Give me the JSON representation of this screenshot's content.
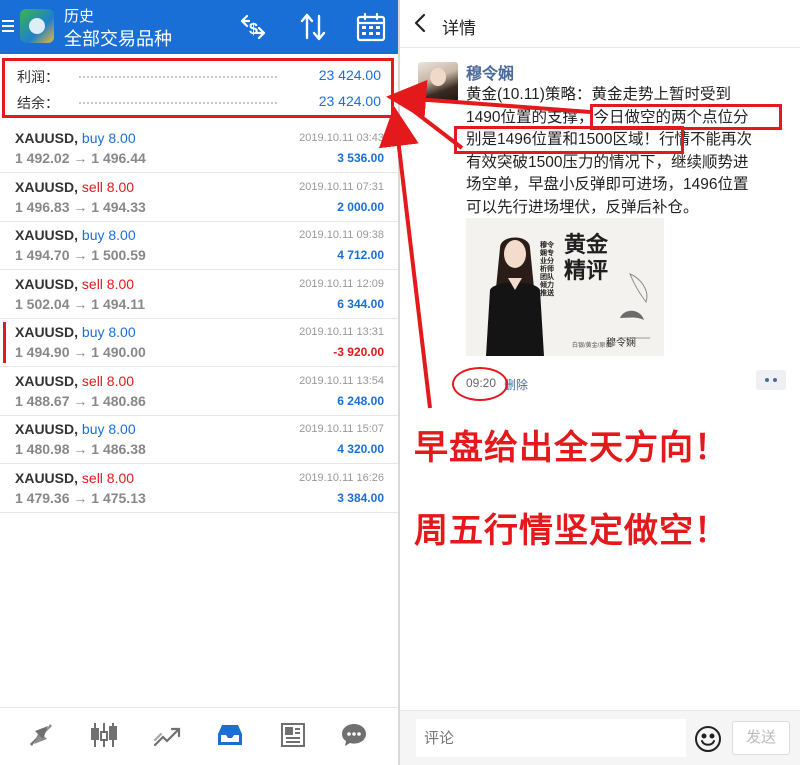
{
  "left": {
    "header": {
      "title_small": "历史",
      "title_big": "全部交易品种",
      "icons": [
        "currency-exchange-icon",
        "sort-icon",
        "calendar-icon"
      ]
    },
    "summary": {
      "profit_label": "利润：",
      "profit_value": "23 424.00",
      "balance_label": "结余：",
      "balance_value": "23 424.00"
    },
    "trades": [
      {
        "symbol": "XAUUSD,",
        "side": "buy 8.00",
        "type": "buy",
        "prices": "1 492.02 → 1 496.44",
        "time": "2019.10.11 03:43",
        "profit": "3 536.00",
        "negative": false
      },
      {
        "symbol": "XAUUSD,",
        "side": "sell 8.00",
        "type": "sell",
        "prices": "1 496.83 → 1 494.33",
        "time": "2019.10.11 07:31",
        "profit": "2 000.00",
        "negative": false
      },
      {
        "symbol": "XAUUSD,",
        "side": "buy 8.00",
        "type": "buy",
        "prices": "1 494.70 → 1 500.59",
        "time": "2019.10.11 09:38",
        "profit": "4 712.00",
        "negative": false
      },
      {
        "symbol": "XAUUSD,",
        "side": "sell 8.00",
        "type": "sell",
        "prices": "1 502.04 → 1 494.11",
        "time": "2019.10.11 12:09",
        "profit": "6 344.00",
        "negative": false
      },
      {
        "symbol": "XAUUSD,",
        "side": "buy 8.00",
        "type": "buy",
        "prices": "1 494.90 → 1 490.00",
        "time": "2019.10.11 13:31",
        "profit": "-3 920.00",
        "negative": true
      },
      {
        "symbol": "XAUUSD,",
        "side": "sell 8.00",
        "type": "sell",
        "prices": "1 488.67 → 1 480.86",
        "time": "2019.10.11 13:54",
        "profit": "6 248.00",
        "negative": false
      },
      {
        "symbol": "XAUUSD,",
        "side": "buy 8.00",
        "type": "buy",
        "prices": "1 480.98 → 1 486.38",
        "time": "2019.10.11 15:07",
        "profit": "4 320.00",
        "negative": false
      },
      {
        "symbol": "XAUUSD,",
        "side": "sell 8.00",
        "type": "sell",
        "prices": "1 479.36 → 1 475.13",
        "time": "2019.10.11 16:26",
        "profit": "3 384.00",
        "negative": false
      }
    ],
    "bottom_nav": [
      "quotes-icon",
      "chart-icon",
      "trade-icon",
      "history-icon",
      "news-icon",
      "messages-icon"
    ]
  },
  "right": {
    "header": {
      "title": "详情"
    },
    "author": "穆令娴",
    "post_lines": [
      "黄金(10.11)策略：黄金走势上暂时受到",
      "1490位置的支撑，今日做空的两个点位分",
      "别是1496位置和1500区域！行情不能再次",
      "有效突破1500压力的情况下，继续顺势进",
      "场空单，早盘小反弹即可进场，1496位置",
      "可以先行进场埋伏，反弹后补仓。"
    ],
    "image": {
      "title": "黄金精评",
      "vertical_text": "穆令娴专业分析师团队倾力推送",
      "bottom_text": "白银/黄金/原油",
      "signature": "穆令娴"
    },
    "time": "09:20",
    "delete_label": "删除",
    "annotations": [
      "早盘给出全天方向！",
      "周五行情坚定做空！"
    ],
    "comment": {
      "placeholder": "评论",
      "send_label": "发送"
    }
  },
  "colors": {
    "brand_blue": "#1a6fd6",
    "annotation_red": "#e3191c",
    "link_blue": "#4a6a9b"
  }
}
